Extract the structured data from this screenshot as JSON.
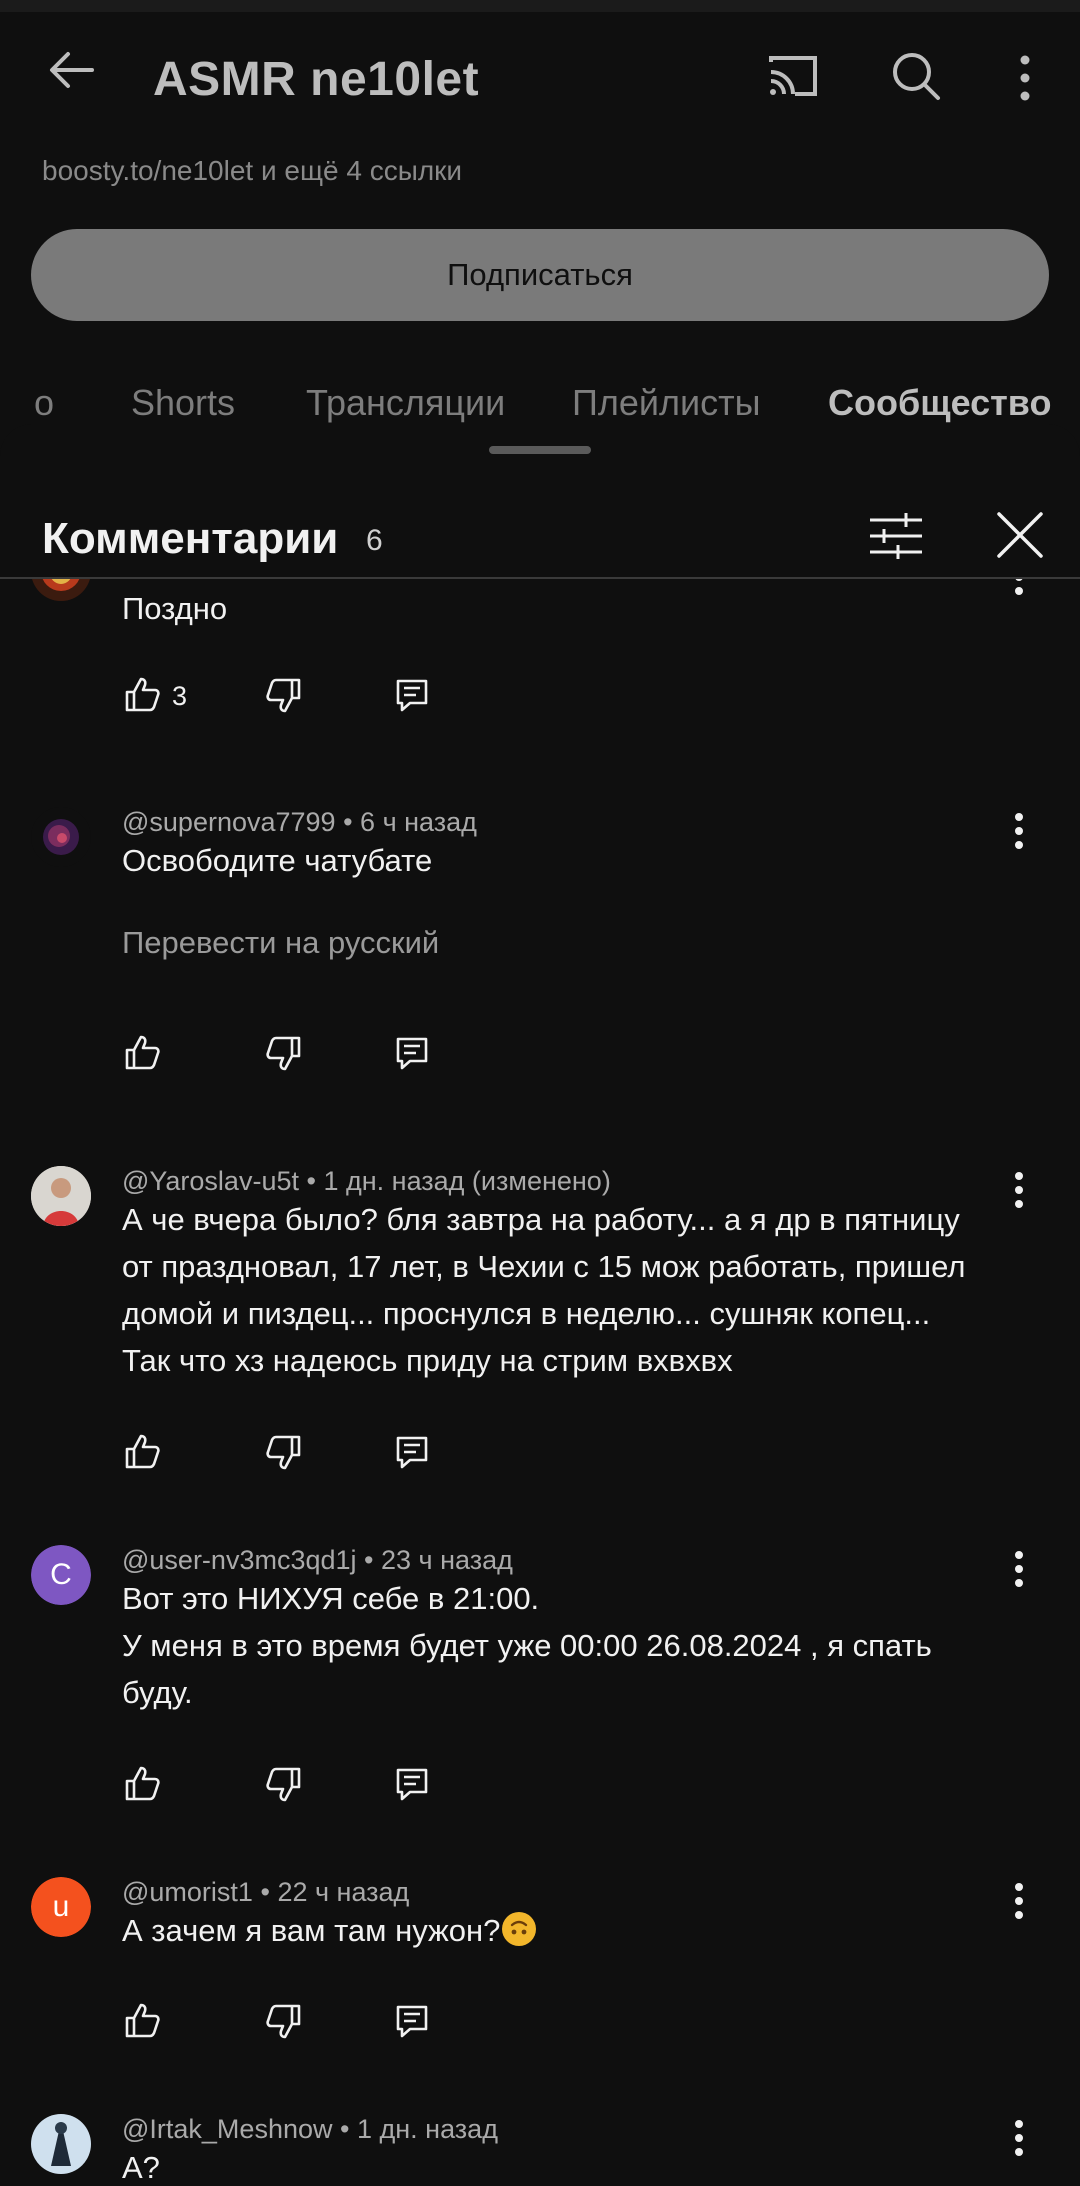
{
  "app_bar": {
    "title": "ASMR ne10let",
    "icons": [
      "back-arrow-icon",
      "cast-icon",
      "search-icon",
      "more-vert-icon"
    ]
  },
  "channel": {
    "links_text": "boosty.to/ne10let и ещё 4 ссылки",
    "subscribe_label": "Подписаться"
  },
  "tabs": [
    {
      "label": "о"
    },
    {
      "label": "Shorts"
    },
    {
      "label": "Трансляции"
    },
    {
      "label": "Плейлисты"
    },
    {
      "label": "Сообщество",
      "active": true
    }
  ],
  "comments_sheet": {
    "title": "Комментарии",
    "count": "6"
  },
  "comments": [
    {
      "author": "",
      "time": "",
      "text": "Поздно",
      "likes": "3",
      "avatar": "lion-avatar"
    },
    {
      "author": "@supernova7799",
      "time": "6 ч назад",
      "text": "Освободите чатубате",
      "translate": "Перевести на русский",
      "likes": "",
      "avatar": "nebula-avatar"
    },
    {
      "author": "@Yaroslav-u5t",
      "time": "1 дн. назад (изменено)",
      "lines": [
        "А че вчера было? бля завтра на работу... а я др в пятницу",
        "от праздновал,  17 лет, в Чехии с 15 мож работать, пришел",
        "домой и пиздец... проснулся в неделю... сушняк копец...",
        "Так что хз надеюсь приду на стрим вхвхвх"
      ],
      "likes": "",
      "avatar": "photo-avatar"
    },
    {
      "author": "@user-nv3mc3qd1j",
      "time": "23 ч назад",
      "lines": [
        "Вот это НИХУЯ себе в 21:00.",
        "У меня в это время будет уже 00:00 26.08.2024 , я спать",
        "буду."
      ],
      "likes": "",
      "avatar_letter": "С",
      "avatar_color": "#7e57c2"
    },
    {
      "author": "@umorist1",
      "time": "22 ч назад",
      "text": "А зачем я вам там нужон?",
      "likes": "",
      "avatar_letter": "u",
      "avatar_color": "#f4511e"
    },
    {
      "author": "@Irtak_Meshnow",
      "time": "1 дн. назад",
      "text": "А?",
      "likes": "",
      "avatar": "figure-avatar"
    }
  ],
  "separator": "•",
  "colors": {
    "background": "#0f0f0f",
    "text_primary": "#f1f1f1",
    "text_secondary": "#aaaaaa",
    "subscribe_bg": "#7a7a7a"
  }
}
